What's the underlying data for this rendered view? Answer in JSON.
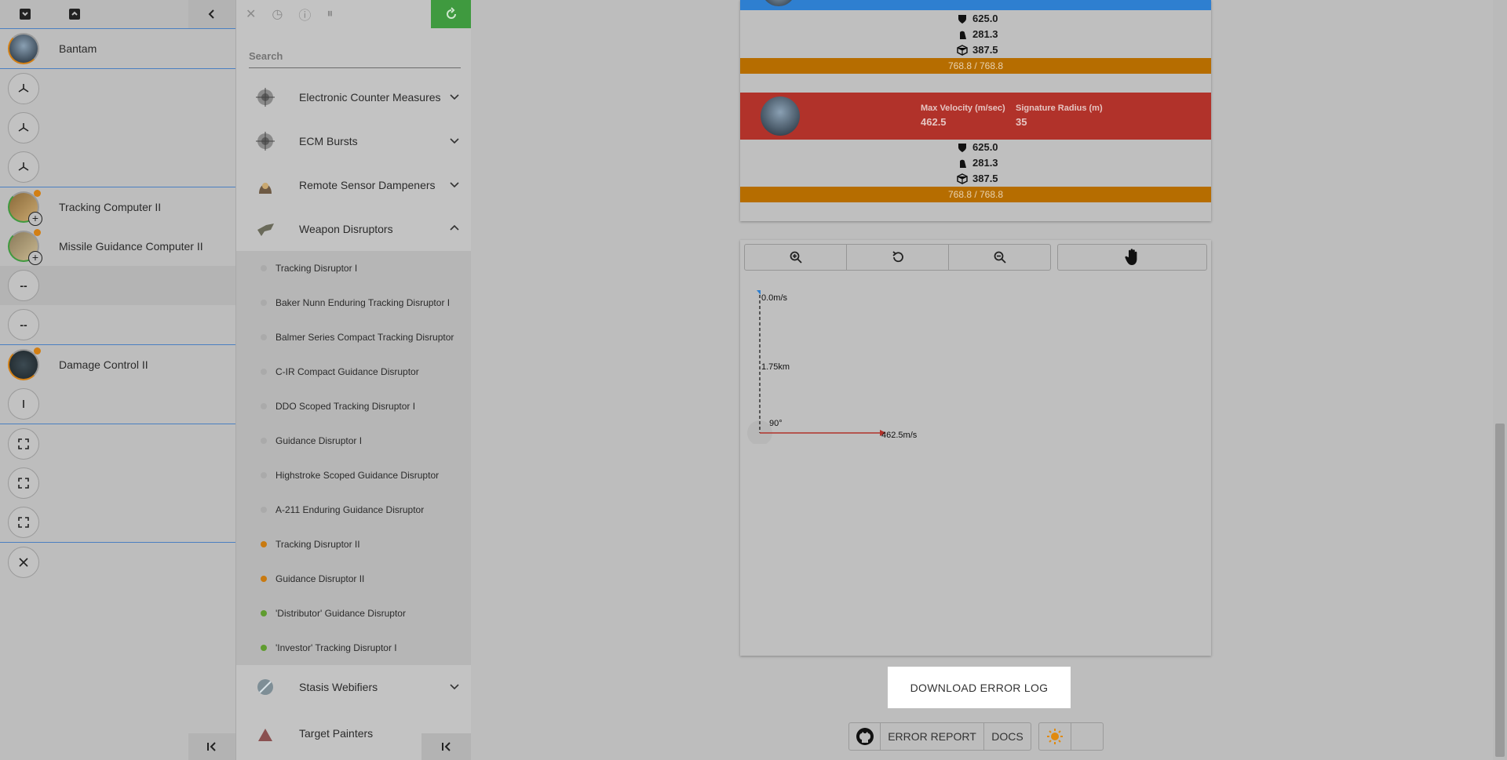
{
  "fit": {
    "ship_name": "Bantam",
    "slots": [
      {
        "label": ""
      },
      {
        "label": ""
      },
      {
        "label": ""
      },
      {
        "label": "Tracking Computer II"
      },
      {
        "label": "Missile Guidance Computer II"
      },
      {
        "label": "--"
      },
      {
        "label": "--"
      },
      {
        "label": "Damage Control II"
      },
      {
        "label": ""
      },
      {
        "label": ""
      },
      {
        "label": ""
      },
      {
        "label": ""
      },
      {
        "label": ""
      }
    ],
    "empty_slot_text": "--"
  },
  "market": {
    "search_placeholder": "Search",
    "categories": [
      {
        "label": "Electronic Counter Measures"
      },
      {
        "label": "ECM Bursts"
      },
      {
        "label": "Remote Sensor Dampeners"
      },
      {
        "label": "Weapon Disruptors"
      },
      {
        "label": "Stasis Webifiers"
      },
      {
        "label": "Target Painters"
      }
    ],
    "items": [
      {
        "label": "Tracking Disruptor I",
        "meta": "none"
      },
      {
        "label": "Baker Nunn Enduring Tracking Disruptor I",
        "meta": "none"
      },
      {
        "label": "Balmer Series Compact Tracking Disruptor",
        "meta": "none"
      },
      {
        "label": "C-IR Compact Guidance Disruptor",
        "meta": "none"
      },
      {
        "label": "DDO Scoped Tracking Disruptor I",
        "meta": "none"
      },
      {
        "label": "Guidance Disruptor I",
        "meta": "none"
      },
      {
        "label": "Highstroke Scoped Guidance Disruptor",
        "meta": "none"
      },
      {
        "label": "A-211 Enduring Guidance Disruptor",
        "meta": "none"
      },
      {
        "label": "Tracking Disruptor II",
        "meta": "t2"
      },
      {
        "label": "Guidance Disruptor II",
        "meta": "t2"
      },
      {
        "label": "'Distributor' Guidance Disruptor",
        "meta": "faction"
      },
      {
        "label": "'Investor' Tracking Disruptor I",
        "meta": "faction"
      }
    ]
  },
  "targets": [
    {
      "shield": "625.0",
      "armor": "281.3",
      "structure": "387.5",
      "bar": "768.8 / 768.8",
      "header_color": "#2e7fd0"
    },
    {
      "velocity_label": "Max Velocity (m/sec)",
      "velocity": "462.5",
      "sig_label": "Signature Radius (m)",
      "sig": "35",
      "shield": "625.0",
      "armor": "281.3",
      "structure": "387.5",
      "bar": "768.8 / 768.8",
      "header_color": "#b1322a"
    }
  ],
  "graph": {
    "top_label": "0.0m/s",
    "mid_label": "1.75km",
    "angle_label": "90°",
    "vel_label": "462.5m/s"
  },
  "footer": {
    "download": "DOWNLOAD ERROR LOG",
    "error_report": "ERROR REPORT",
    "docs": "DOCS"
  },
  "colors": {
    "accent_green": "#3f9a3f",
    "t2_dot": "#c97a10",
    "faction_dot": "#5f9c2f",
    "slot_divider": "#4a7fc1"
  }
}
